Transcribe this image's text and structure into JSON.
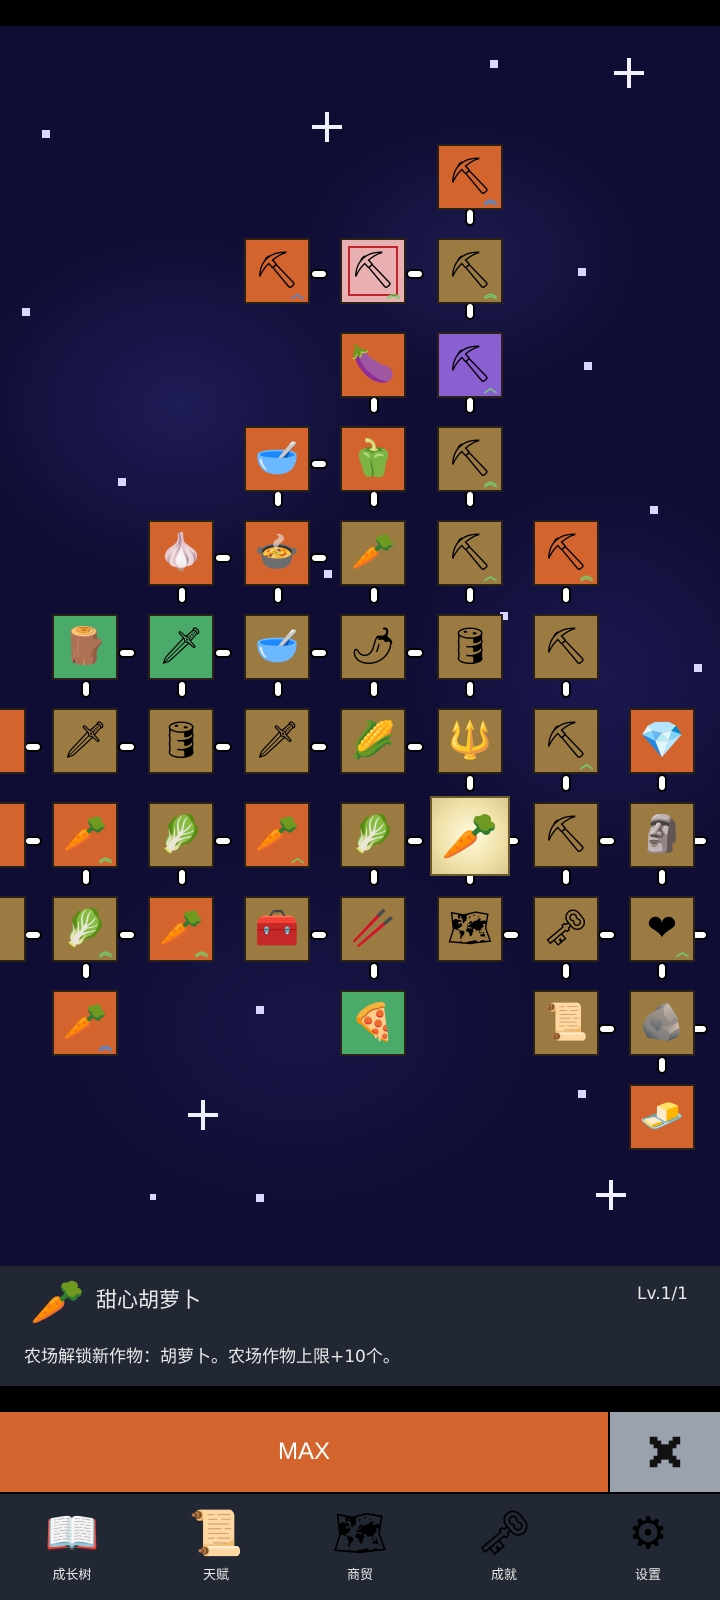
{
  "info": {
    "icon": "carrot-icon",
    "title": "甜心胡萝卜",
    "level": "Lv.1/1",
    "description": "农场解锁新作物：胡萝卜。农场作物上限+10个。"
  },
  "actions": {
    "max_label": "MAX",
    "close_icon": "close-icon"
  },
  "nav": {
    "items": [
      {
        "icon": "book-icon",
        "label": "成长树"
      },
      {
        "icon": "scroll-icon",
        "label": "天赋"
      },
      {
        "icon": "map-icon",
        "label": "商贸"
      },
      {
        "icon": "key-icon",
        "label": "成就"
      },
      {
        "icon": "gear-icon",
        "label": "设置"
      }
    ]
  },
  "tree": {
    "selected": "carrot-node",
    "colors": {
      "orange": "#d4642e",
      "tan": "#9b7b41",
      "green": "#4aaa6a",
      "purple": "#8a5fd1"
    }
  }
}
